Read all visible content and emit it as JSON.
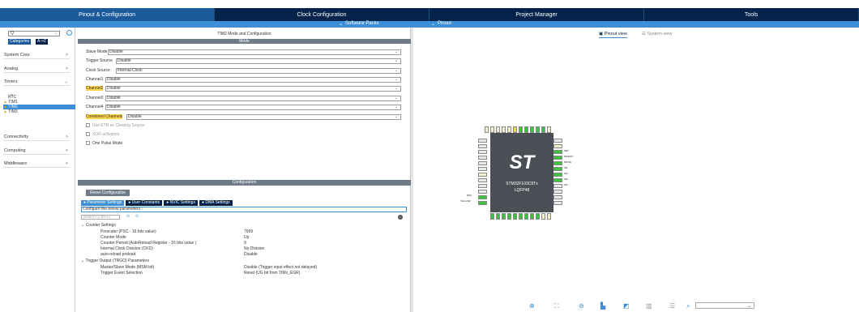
{
  "tabs": [
    {
      "label": "Pinout & Configuration",
      "active": true
    },
    {
      "label": "Clock Configuration",
      "active": false
    },
    {
      "label": "Project Manager",
      "active": false
    },
    {
      "label": "Tools",
      "active": false
    }
  ],
  "subbar": {
    "software_packs": "Software Packs",
    "pinout": "Pinout"
  },
  "left": {
    "search_value": "Q",
    "btn_categories": "Categories",
    "btn_az": "A->Z",
    "categories": [
      "System Core",
      "Analog",
      "Timers",
      "Connectivity",
      "Computing",
      "Middleware"
    ],
    "timers": [
      "RTC",
      "TIM1",
      "TIM2",
      "TIM3"
    ]
  },
  "mid": {
    "header": "TIM2 Mode and Configuration",
    "mode_bar": "Mode",
    "rows": [
      {
        "label": "Slave Mode",
        "value": "Disable"
      },
      {
        "label": "Trigger Source",
        "value": "Disable"
      },
      {
        "label": "Clock Source",
        "value": "Internal Clock"
      },
      {
        "label": "Channel1",
        "value": "Disable"
      },
      {
        "label": "Channel2",
        "value": "Disable"
      },
      {
        "label": "Channel3",
        "value": "Disable"
      },
      {
        "label": "Channel4",
        "value": "Disable"
      },
      {
        "label": "Combined Channels",
        "value": "Disable"
      }
    ],
    "checks": [
      "Use ETR as Clearing Source",
      "XOR activation",
      "One Pulse Mode"
    ],
    "config_bar": "Configuration",
    "reset_button": "Reset Configuration",
    "param_tabs": [
      "Parameter Settings",
      "User Constants",
      "NVIC Settings",
      "DMA Settings"
    ],
    "configure_text": "Configure the below parameters :",
    "search_placeholder": "Search (Ctrl+F)",
    "groups": [
      {
        "title": "Counter Settings",
        "params": [
          {
            "name": "Prescaler (PSC - 16 bits value)",
            "value": "7999"
          },
          {
            "name": "Counter Mode",
            "value": "Up"
          },
          {
            "name": "Counter Period (AutoReload Register - 16 bits value )",
            "value": "9"
          },
          {
            "name": "Internal Clock Division (CKD)",
            "value": "No Division"
          },
          {
            "name": "auto-reload preload",
            "value": "Disable"
          }
        ]
      },
      {
        "title": "Trigger Output (TRGO) Parameters",
        "params": [
          {
            "name": "Master/Slave Mode (MSM bit)",
            "value": "Disable (Trigger input effect not delayed)"
          },
          {
            "name": "Trigger Event Selection",
            "value": "Reset (UG bit from TIMx_EGR)"
          }
        ]
      }
    ]
  },
  "right": {
    "pinout_view": "Pinout view",
    "system_view": "System view",
    "chip_name": "STM32F103C8Tx",
    "package": "LQFP48",
    "right_labels": [
      "SET",
      "MODIFY",
      "MOVE",
      "IN1",
      "IN2",
      "IN3",
      "IN4"
    ],
    "left_labels": [
      "RS0",
      "YELLOW"
    ]
  }
}
